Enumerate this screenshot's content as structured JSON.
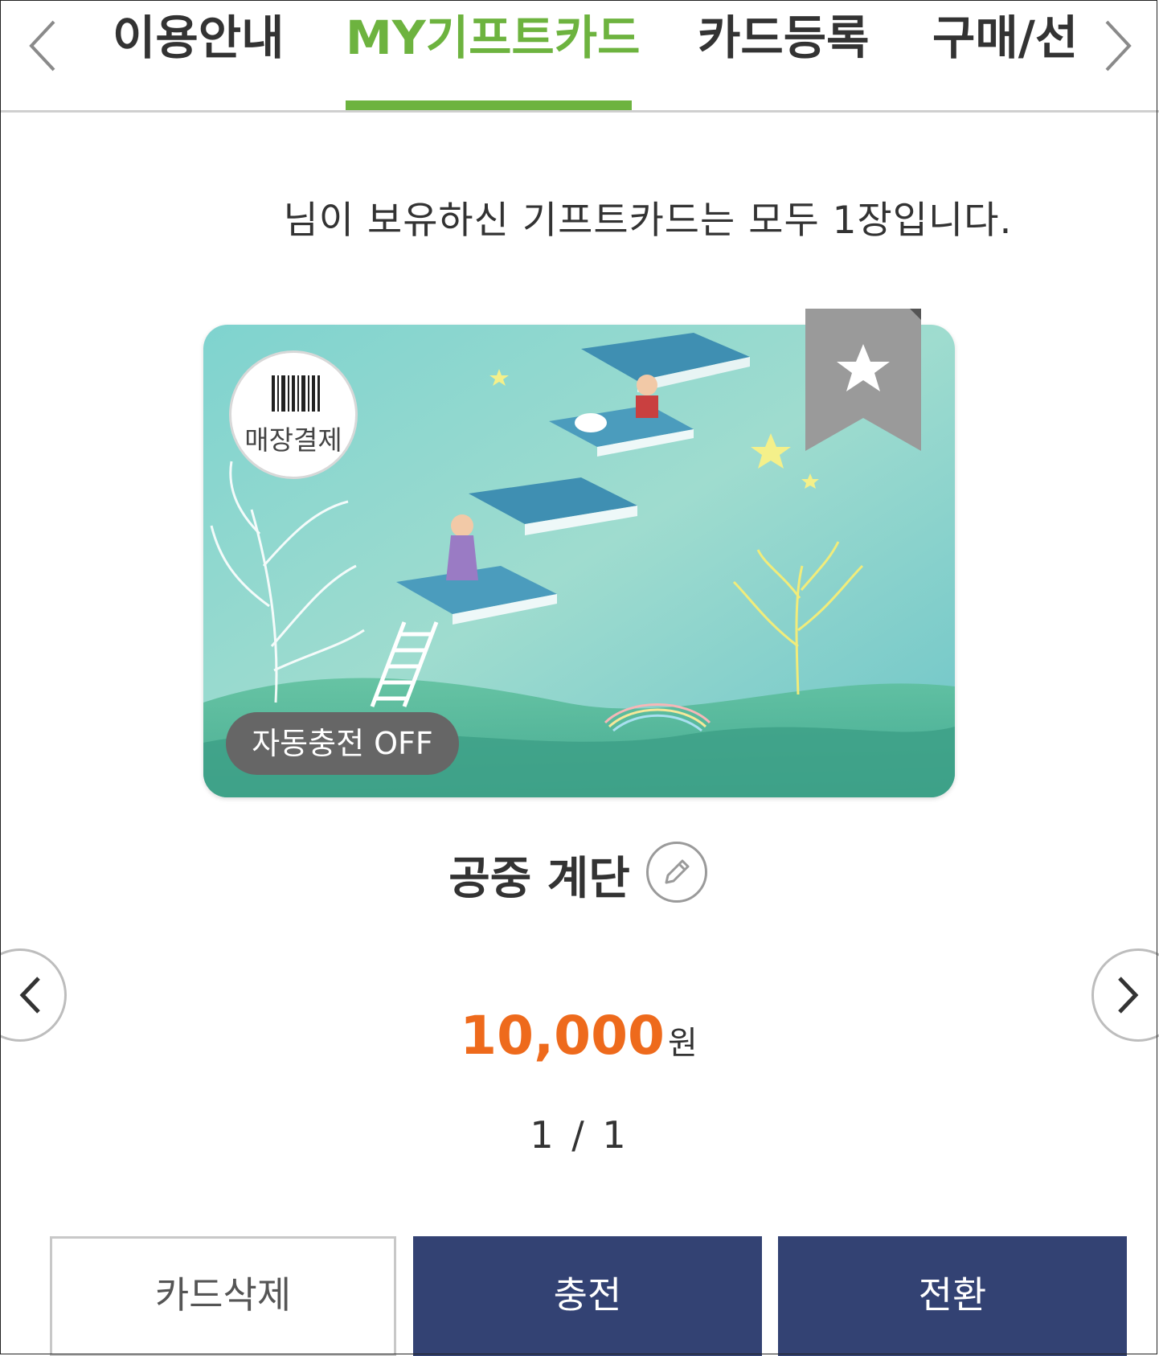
{
  "tabs": [
    {
      "label": "이용안내",
      "active": false
    },
    {
      "label": "MY기프트카드",
      "active": true
    },
    {
      "label": "카드등록",
      "active": false
    },
    {
      "label": "구매/선",
      "active": false
    }
  ],
  "summary": "님이 보유하신 기프트카드는 모두 1장입니다.",
  "card": {
    "store_pay_label": "매장결제",
    "auto_charge_label": "자동충전 OFF",
    "name": "공중 계단",
    "icons": [
      "barcode-icon",
      "star-bookmark-icon",
      "pencil-icon"
    ]
  },
  "balance": {
    "amount": "10,000",
    "unit": "원"
  },
  "pager": "1 / 1",
  "buttons": {
    "delete": "카드삭제",
    "charge": "충전",
    "convert": "전환"
  },
  "colors": {
    "accent": "#6db33f",
    "amount": "#ee6a1c",
    "primary_button": "#334273"
  }
}
